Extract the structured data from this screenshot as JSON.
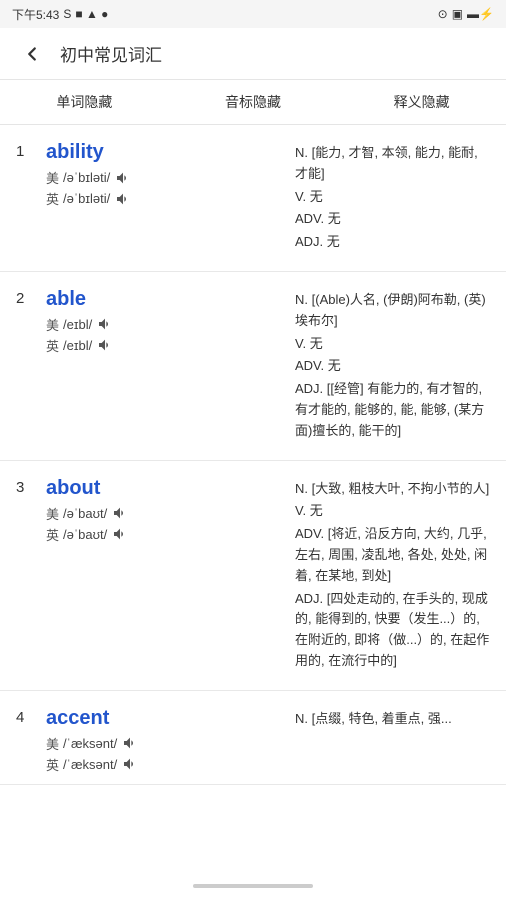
{
  "statusBar": {
    "time": "下午5:43",
    "signal": "S",
    "battery": "⚡"
  },
  "header": {
    "backLabel": "←",
    "title": "初中常见词汇"
  },
  "tabs": [
    {
      "id": "word-hide",
      "label": "单词隐藏"
    },
    {
      "id": "phonetic-hide",
      "label": "音标隐藏"
    },
    {
      "id": "def-hide",
      "label": "释义隐藏"
    }
  ],
  "words": [
    {
      "number": "1",
      "word": "ability",
      "phonetics": [
        {
          "lang": "美",
          "ipa": "/əˈbɪləti/"
        },
        {
          "lang": "英",
          "ipa": "/əˈbɪləti/"
        }
      ],
      "definitions": [
        {
          "pos": "N.",
          "text": "[能力, 才智, 本领, 能力, 能耐, 才能]"
        },
        {
          "pos": "V.",
          "text": "无"
        },
        {
          "pos": "ADV.",
          "text": "无"
        },
        {
          "pos": "ADJ.",
          "text": "无"
        }
      ]
    },
    {
      "number": "2",
      "word": "able",
      "phonetics": [
        {
          "lang": "美",
          "ipa": "/eɪbl/"
        },
        {
          "lang": "英",
          "ipa": "/eɪbl/"
        }
      ],
      "definitions": [
        {
          "pos": "N.",
          "text": "[(Able)人名, (伊朗)阿布勒, (英)埃布尔]"
        },
        {
          "pos": "V.",
          "text": "无"
        },
        {
          "pos": "ADV.",
          "text": "无"
        },
        {
          "pos": "ADJ.",
          "text": "[[经管] 有能力的, 有才智的, 有才能的, 能够的, 能, 能够, (某方面)擅长的, 能干的]"
        }
      ]
    },
    {
      "number": "3",
      "word": "about",
      "phonetics": [
        {
          "lang": "美",
          "ipa": "/əˈbaʊt/"
        },
        {
          "lang": "英",
          "ipa": "/əˈbaʊt/"
        }
      ],
      "definitions": [
        {
          "pos": "N.",
          "text": "[大致, 粗枝大叶, 不拘小节的人]"
        },
        {
          "pos": "V.",
          "text": "无"
        },
        {
          "pos": "ADV.",
          "text": "[将近, 沿反方向, 大约, 几乎, 左右, 周围, 凌乱地, 各处, 处处, 闲着, 在某地, 到处]"
        },
        {
          "pos": "ADJ.",
          "text": "[四处走动的, 在手头的, 现成的, 能得到的, 快要（发生...）的, 在附近的, 即将（做...）的, 在起作用的, 在流行中的]"
        }
      ]
    },
    {
      "number": "4",
      "word": "accent",
      "phonetics": [
        {
          "lang": "美",
          "ipa": "/ˈæksənt/"
        },
        {
          "lang": "英",
          "ipa": "/ˈæksənt/"
        }
      ],
      "definitions": [
        {
          "pos": "N.",
          "text": "[点缀, 特色, 着重点, 强..."
        }
      ]
    }
  ]
}
